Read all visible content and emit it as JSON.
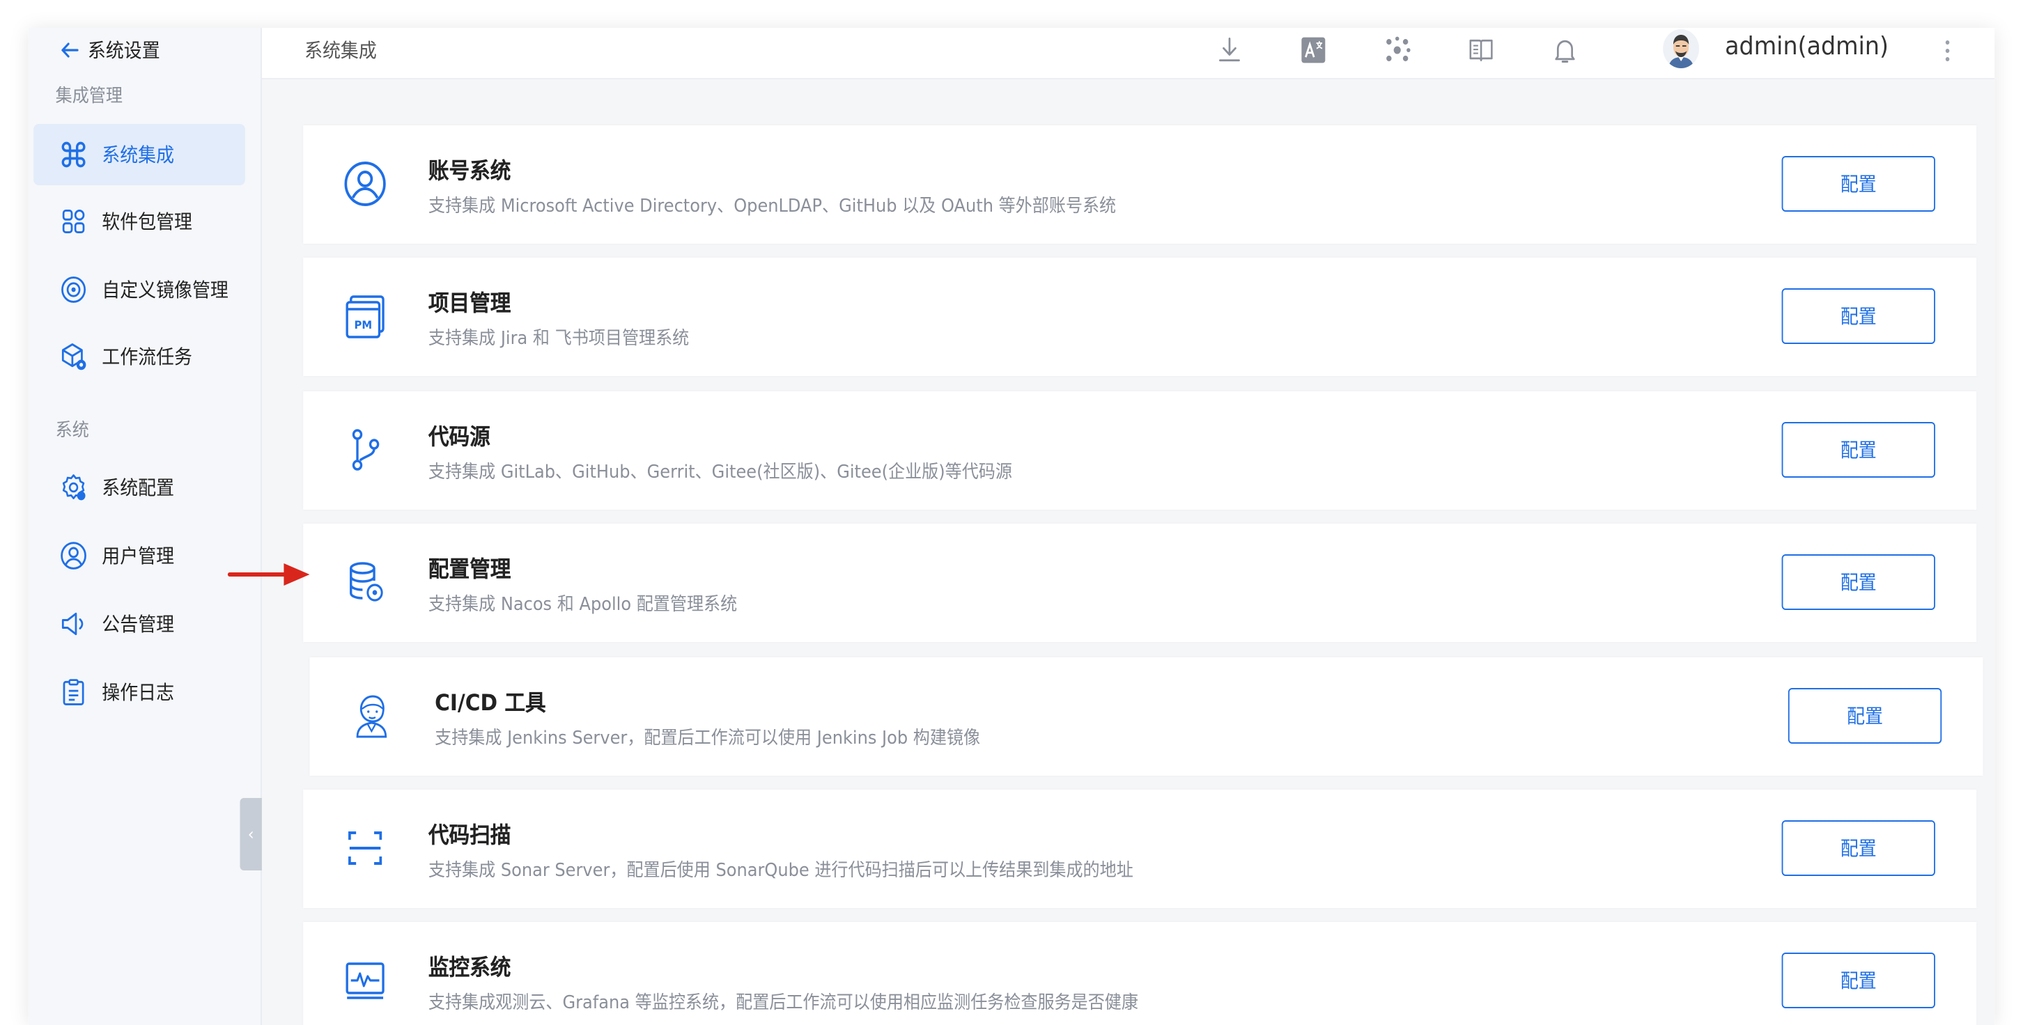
{
  "sidebar": {
    "back_label": "系统设置",
    "groups": [
      {
        "title": "集成管理"
      },
      {
        "title": "系统"
      }
    ],
    "items": [
      {
        "label": "系统集成",
        "icon": "integration-icon",
        "active": true
      },
      {
        "label": "软件包管理",
        "icon": "package-icon"
      },
      {
        "label": "自定义镜像管理",
        "icon": "image-icon"
      },
      {
        "label": "工作流任务",
        "icon": "workflow-task-icon"
      },
      {
        "label": "系统配置",
        "icon": "settings-icon"
      },
      {
        "label": "用户管理",
        "icon": "user-icon"
      },
      {
        "label": "公告管理",
        "icon": "announcement-icon"
      },
      {
        "label": "操作日志",
        "icon": "log-icon"
      }
    ]
  },
  "header": {
    "title": "系统集成",
    "icons": [
      "download-icon",
      "translate-icon",
      "plugin-icon",
      "docs-icon",
      "bell-icon"
    ],
    "user": "admin(admin)"
  },
  "cards": [
    {
      "title": "账号系统",
      "desc": "支持集成 Microsoft Active Directory、OpenLDAP、GitHub 以及 OAuth 等外部账号系统",
      "button": "配置",
      "icon": "account-icon"
    },
    {
      "title": "项目管理",
      "desc": "支持集成 Jira 和 飞书项目管理系统",
      "button": "配置",
      "icon": "pm-icon"
    },
    {
      "title": "代码源",
      "desc": "支持集成 GitLab、GitHub、Gerrit、Gitee(社区版)、Gitee(企业版)等代码源",
      "button": "配置",
      "icon": "git-branch-icon"
    },
    {
      "title": "配置管理",
      "desc": "支持集成 Nacos 和 Apollo 配置管理系统",
      "button": "配置",
      "icon": "config-db-icon"
    },
    {
      "title": "CI/CD 工具",
      "desc": "支持集成 Jenkins Server，配置后工作流可以使用 Jenkins Job 构建镜像",
      "button": "配置",
      "icon": "jenkins-icon"
    },
    {
      "title": "代码扫描",
      "desc": "支持集成 Sonar Server，配置后使用 SonarQube 进行代码扫描后可以上传结果到集成的地址",
      "button": "配置",
      "icon": "scan-icon"
    },
    {
      "title": "监控系统",
      "desc": "支持集成观测云、Grafana 等监控系统，配置后工作流可以使用相应监测任务检查服务是否健康",
      "button": "配置",
      "icon": "monitor-icon"
    }
  ],
  "colors": {
    "accent": "#1f6fe6",
    "active_bg": "#e3ecfa",
    "arrow": "#d9261c"
  }
}
